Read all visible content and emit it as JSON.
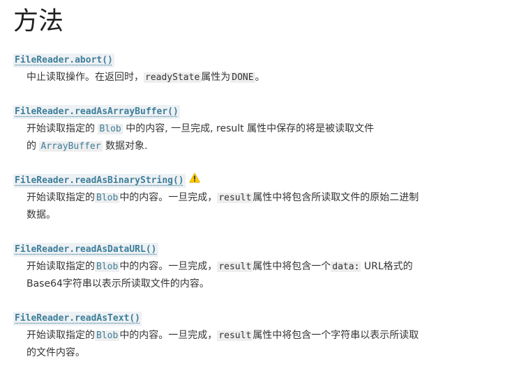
{
  "title": "方法",
  "methods": [
    {
      "name": "FileReader.abort()",
      "desc": {
        "a": "中止读取操作。在返回时，",
        "code1": "readyState",
        "b": "属性为",
        "code2": "DONE",
        "c": "。"
      }
    },
    {
      "name": "FileReader.readAsArrayBuffer()",
      "desc": {
        "a": "开始读取指定的 ",
        "code1": "Blob",
        "b": " 中的内容, 一旦完成, result 属性中保存的将是被读取文件",
        "b2": "的 ",
        "code2": "ArrayBuffer",
        "c": " 数据对象."
      }
    },
    {
      "name": "FileReader.readAsBinaryString()",
      "warning_icon": "warning-triangle-icon",
      "desc": {
        "a": "开始读取指定的",
        "code1": "Blob",
        "b": "中的内容。一旦完成，",
        "code2": "result",
        "c": "属性中将包含所读取文件的原始二进制",
        "c2": "数据。"
      }
    },
    {
      "name": "FileReader.readAsDataURL()",
      "desc": {
        "a": "开始读取指定的",
        "code1": "Blob",
        "b": "中的内容。一旦完成，",
        "code2": "result",
        "c": "属性中将包含一个",
        "code3": "data:",
        "d": " URL格式的",
        "d2": "Base64字符串以表示所读取文件的内容。"
      }
    },
    {
      "name": "FileReader.readAsText()",
      "desc": {
        "a": "开始读取指定的",
        "code1": "Blob",
        "b": "中的内容。一旦完成，",
        "code2": "result",
        "c": "属性中将包含一个字符串以表示所读取",
        "c2": "的文件内容。"
      }
    }
  ],
  "colors": {
    "term_text": "#3d7e9a",
    "term_bg": "#eef1f4",
    "code_bg": "#eeeeee",
    "warning": "#ffcc00"
  }
}
